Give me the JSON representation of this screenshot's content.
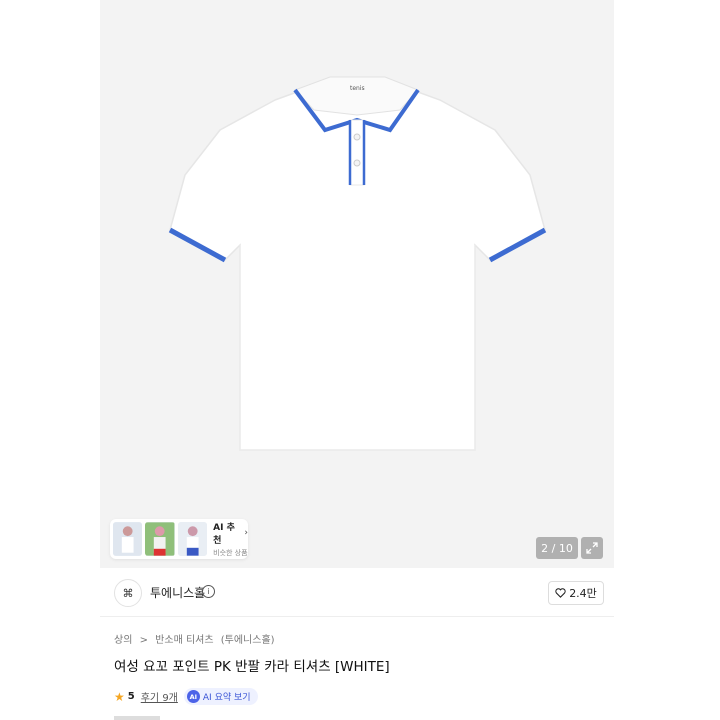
{
  "gallery": {
    "counter": "2 / 10",
    "collar_logo": "tenis",
    "ai_recommend": {
      "title": "AI 추천",
      "subtitle": "비슷한 상품"
    }
  },
  "seller": {
    "logo": "⌘",
    "name": "투에니스홀",
    "likes": "2.4만"
  },
  "product": {
    "breadcrumb": [
      "상의",
      ">",
      "반소매 티셔츠",
      "(투에니스홀)"
    ],
    "title": "여성 요꼬 포인트 PK 반팔 카라 티셔츠 [WHITE]",
    "rating": "5",
    "reviews": "후기 9개",
    "ai_badge": "AI",
    "ai_summary": "AI 요약 보기"
  },
  "colors": {
    "accent_blue": "#3d6bd1",
    "star": "#f5a623"
  }
}
